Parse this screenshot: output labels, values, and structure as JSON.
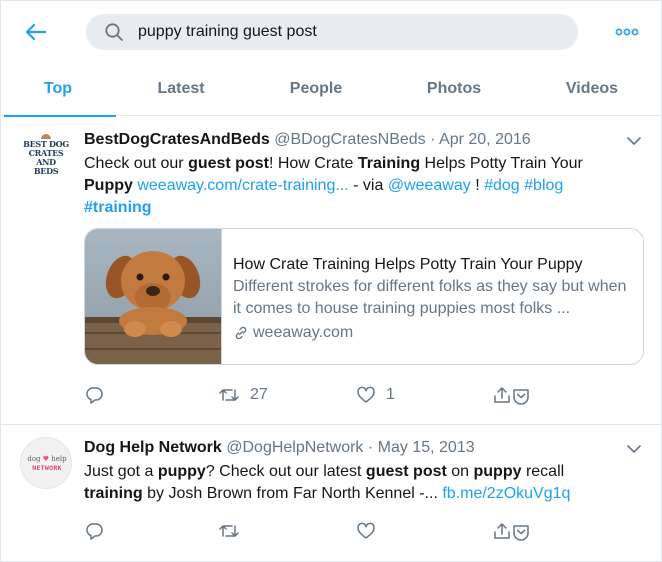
{
  "search": {
    "query": "puppy training guest post"
  },
  "tabs": [
    {
      "label": "Top",
      "active": true
    },
    {
      "label": "Latest"
    },
    {
      "label": "People"
    },
    {
      "label": "Photos"
    },
    {
      "label": "Videos"
    }
  ],
  "colors": {
    "accent": "#1da1f2",
    "muted": "#657786",
    "text": "#14171a",
    "border": "#e1e8ed"
  },
  "tweets": [
    {
      "avatar_text": [
        "BEST DOG",
        "CRATES AND",
        "BEDS"
      ],
      "name": "BestDogCratesAndBeds",
      "handle": "@BDogCratesNBeds",
      "sep": "·",
      "date": "Apr 20, 2016",
      "text": {
        "p1": "Check out our ",
        "b1": "guest post",
        "p2": "! How Crate ",
        "b2": "Training",
        "p3": " Helps Potty Train Your ",
        "b3": "Puppy",
        "sp1": " ",
        "link": "weeaway.com/crate-training...",
        "p4": " - via ",
        "mention": "@weeaway",
        "p5": " ! ",
        "tag1": "#dog",
        "sp2": " ",
        "tag2": "#blog",
        "tag3": "#training"
      },
      "card": {
        "title": "How Crate Training Helps Potty Train Your Puppy",
        "description": "Different strokes for different folks as they say but when it comes to house training puppies most folks ...",
        "domain": "weeaway.com"
      },
      "counts": {
        "retweets": "27",
        "likes": "1"
      }
    },
    {
      "avatar_text": [
        "dog",
        "help",
        "NETWORK"
      ],
      "name": "Dog Help Network",
      "handle": "@DogHelpNetwork",
      "sep": "·",
      "date": "May 15, 2013",
      "text": {
        "p1": "Just got a ",
        "b1": "puppy",
        "p2": "? Check out our latest ",
        "b2": "guest post",
        "p3": " on ",
        "b3": "puppy",
        "p4": " recall ",
        "b4": "training",
        "p5": " by Josh Brown from Far North Kennel -... ",
        "link": "fb.me/2zOkuVg1q"
      }
    }
  ]
}
